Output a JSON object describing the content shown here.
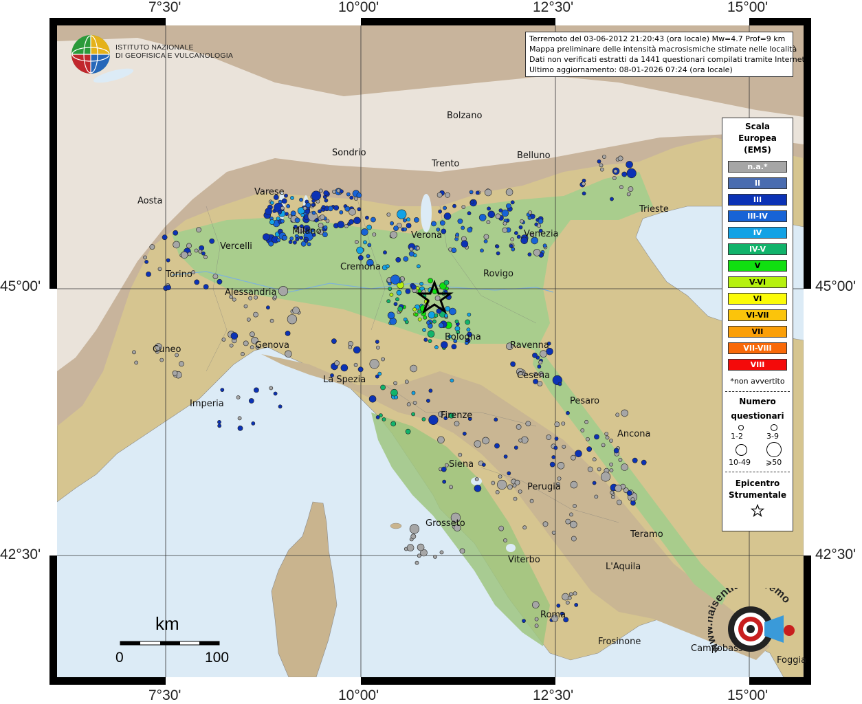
{
  "map": {
    "lon_labels": [
      "7°30'",
      "10°00'",
      "12°30'",
      "15°00'"
    ],
    "lat_labels": [
      "45°00'",
      "42°30'"
    ],
    "colors": {
      "sea": "#dcebf6",
      "plain": "#a5c98a",
      "hill": "#d8c48e",
      "mountain": "#b9a08a",
      "snow": "#f4f1ee"
    }
  },
  "logo": {
    "line1": "ISTITUTO NAZIONALE",
    "line2": "DI GEOFISICA E VULCANOLOGIA",
    "icon": "ingv-globe-logo"
  },
  "info": {
    "line1": "Terremoto del 03-06-2012 21:20:43 (ora locale) Mw=4.7 Prof=9 km",
    "line2": "Mappa preliminare delle intensità macrosismiche stimate nelle località",
    "line3": "Dati non verificati estratti da 1441 questionari compilati tramite Internet.",
    "line4": "Ultimo aggiornamento: 08-01-2026 07:24 (ora locale)"
  },
  "places": [
    "Bolzano",
    "Sondrio",
    "Trento",
    "Belluno",
    "Aosta",
    "Varese",
    "Milano",
    "Trieste",
    "Vercelli",
    "Verona",
    "Venezia",
    "Cremona",
    "Rovigo",
    "Torino",
    "Alessandria",
    "Bologna",
    "Genova",
    "Cuneo",
    "Ravenna",
    "La Spezia",
    "Cesena",
    "Imperia",
    "Pesaro",
    "Firenze",
    "Ancona",
    "Siena",
    "Perugia",
    "Grosseto",
    "Teramo",
    "Viterbo",
    "L'Aquila",
    "Roma",
    "Frosinone",
    "Campobasso",
    "Foggia"
  ],
  "legend": {
    "title_line1": "Scala",
    "title_line2": "Europea",
    "title_line3": "(EMS)",
    "classes": [
      {
        "label": "n.a.*",
        "color": "#a6a6a6"
      },
      {
        "label": "II",
        "color": "#4a6cb0"
      },
      {
        "label": "III",
        "color": "#0b32b5"
      },
      {
        "label": "III-IV",
        "color": "#1763d6"
      },
      {
        "label": "IV",
        "color": "#12a2e5"
      },
      {
        "label": "IV-V",
        "color": "#11b36b"
      },
      {
        "label": "V",
        "color": "#10df10"
      },
      {
        "label": "V-VI",
        "color": "#b6f10e"
      },
      {
        "label": "VI",
        "color": "#fbfb08"
      },
      {
        "label": "VI-VII",
        "color": "#fbc40b"
      },
      {
        "label": "VII",
        "color": "#fb9f08"
      },
      {
        "label": "VII-VIII",
        "color": "#f96908"
      },
      {
        "label": "VIII",
        "color": "#f40a0a"
      }
    ],
    "not_felt_note": "*non avvertito",
    "count_title_line1": "Numero",
    "count_title_line2": "questionari",
    "count_classes": [
      "1-2",
      "3-9",
      "10-49",
      "⩾50"
    ],
    "epicenter_title_line1": "Epicentro",
    "epicenter_title_line2": "Strumentale",
    "epicenter_icon": "star-icon"
  },
  "scalebar": {
    "unit": "km",
    "min": "0",
    "max": "100"
  },
  "epicenter": {
    "icon": "star-icon"
  },
  "watermark": {
    "text": "www.haisentitoilterremoto.it",
    "icon": "target-megaphone-icon"
  }
}
